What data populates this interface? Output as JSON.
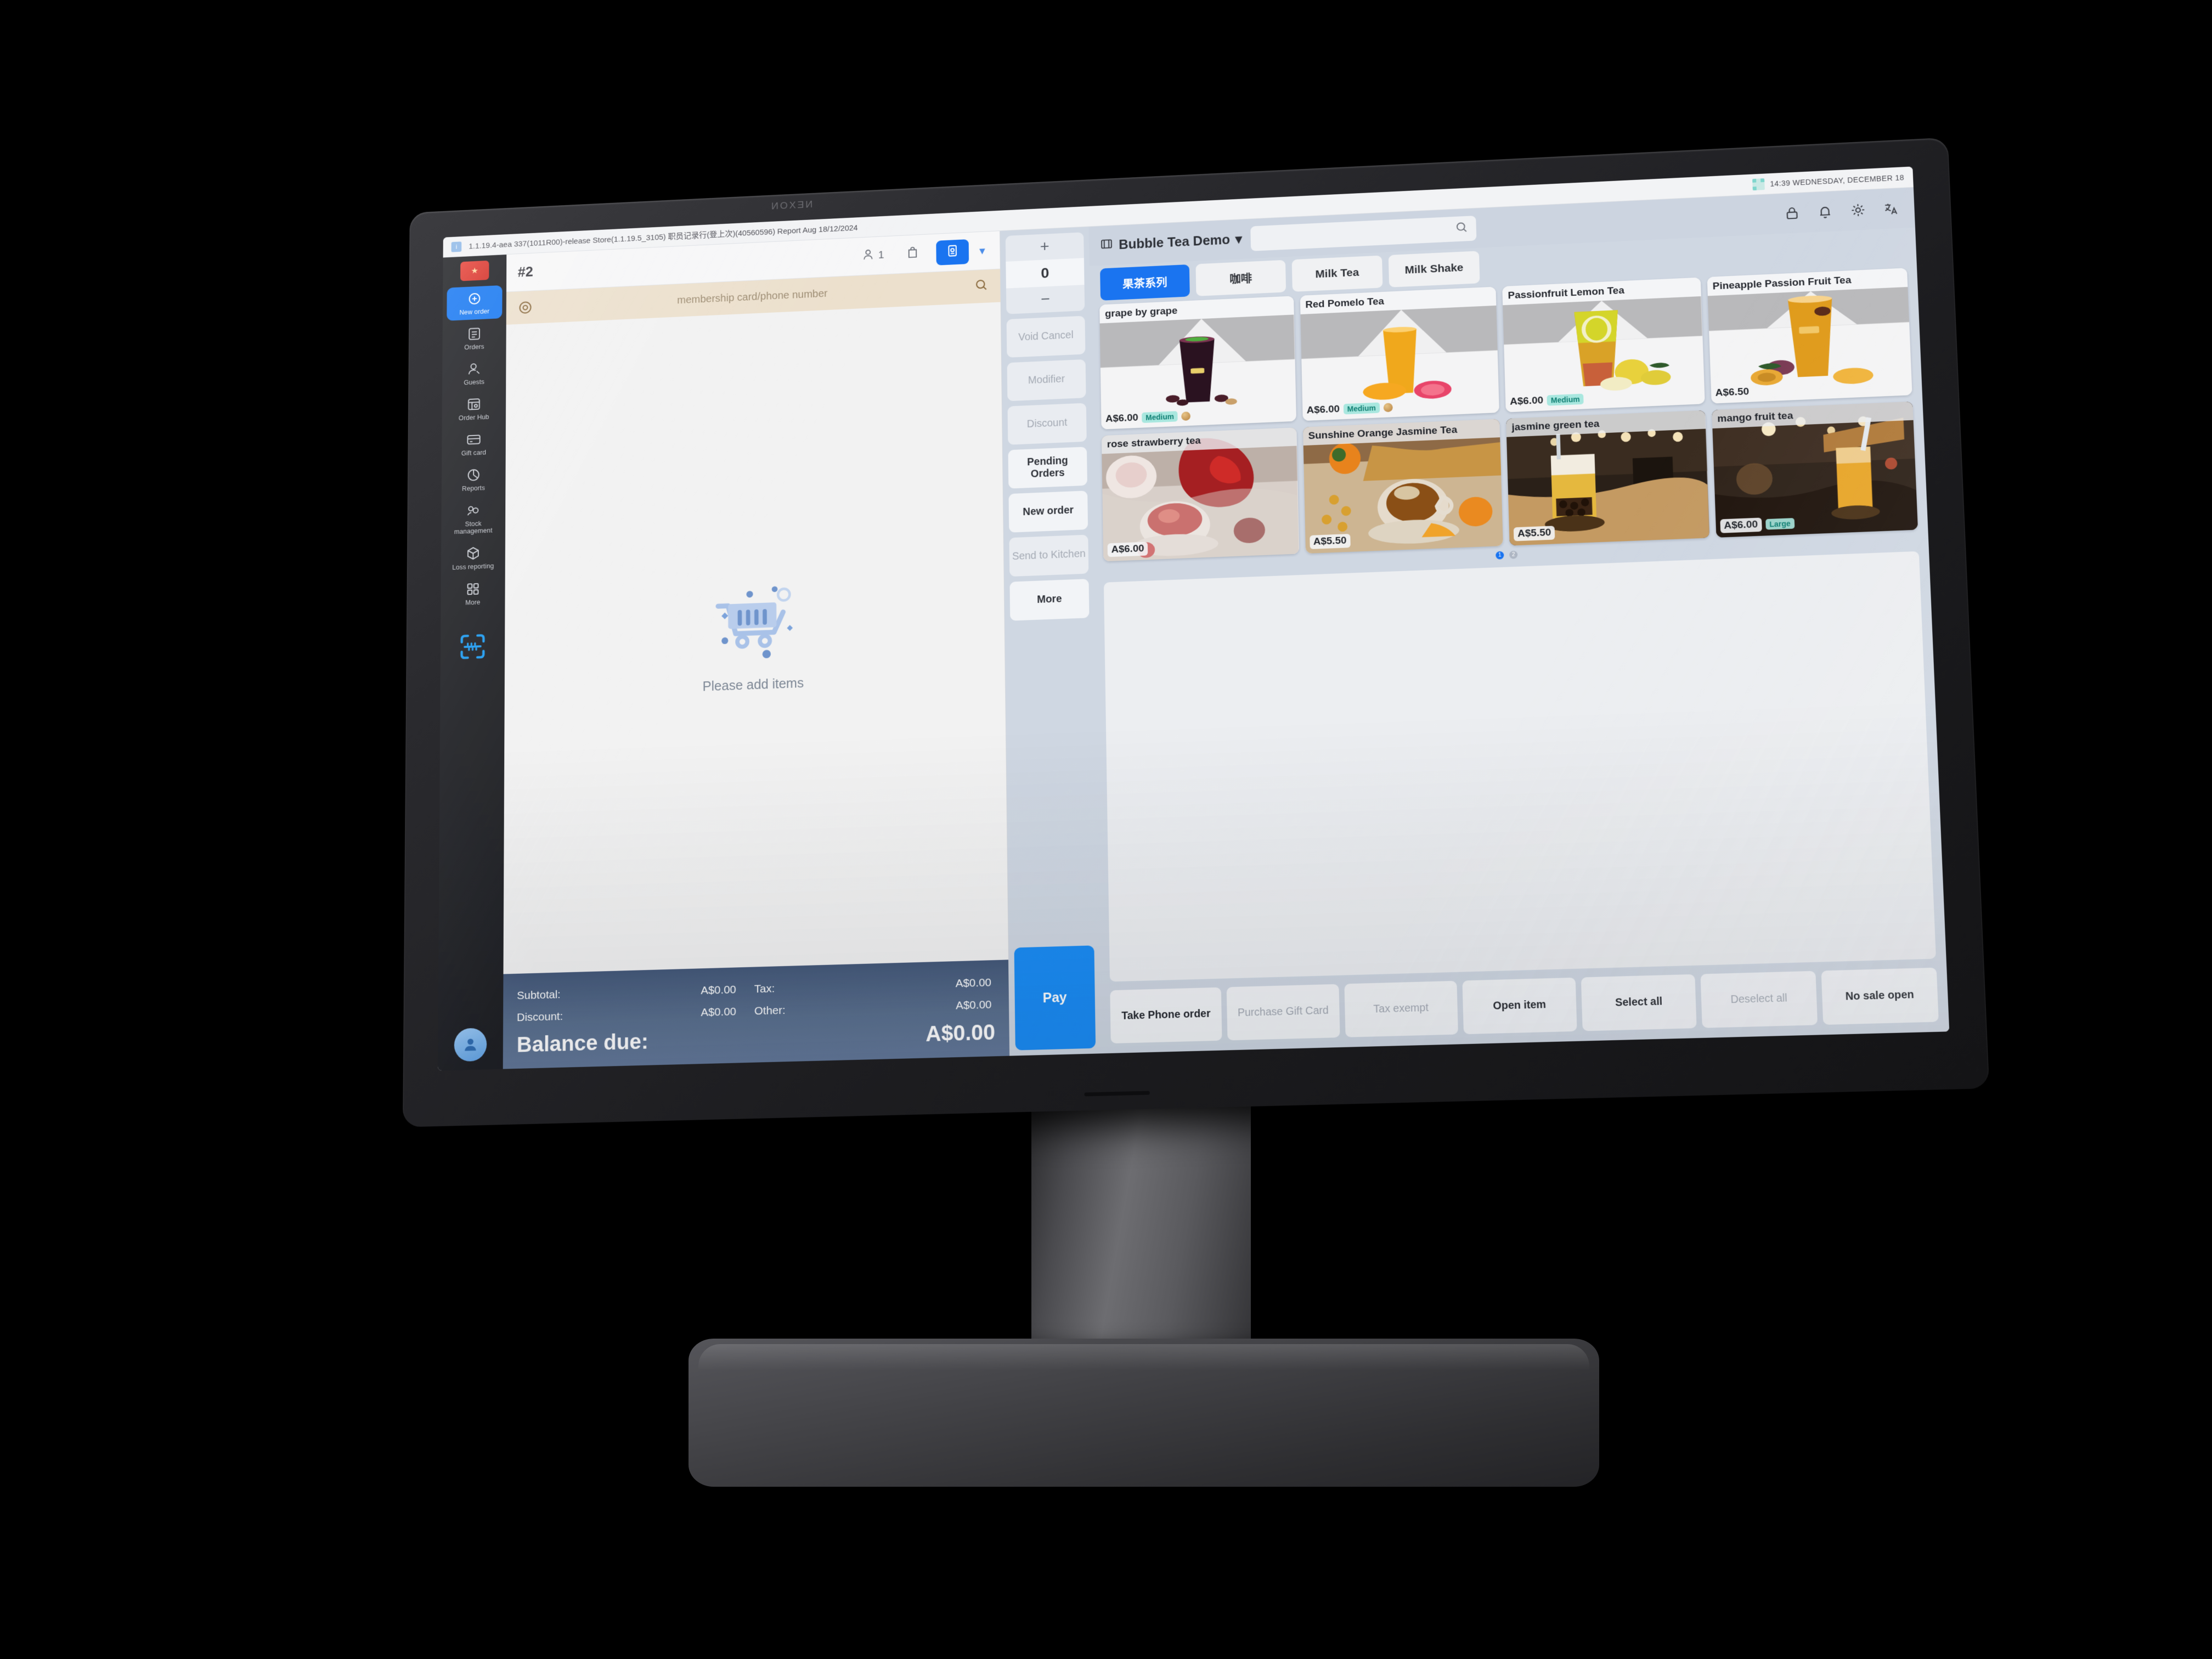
{
  "statusbar": {
    "debug_text": "1.1.19.4-aea 337(1011R00)-release  Store(1.1.19.5_3105)  职员记录行(登上次)(40560596)  Report Aug 18/12/2024",
    "clock": "14:39 WEDNESDAY, DECEMBER 18"
  },
  "sidebar": {
    "items": [
      {
        "label": "New order",
        "icon": "new-order-icon",
        "active": true
      },
      {
        "label": "Orders",
        "icon": "orders-icon",
        "active": false
      },
      {
        "label": "Guests",
        "icon": "guests-icon",
        "active": false
      },
      {
        "label": "Order Hub",
        "icon": "order-hub-icon",
        "active": false
      },
      {
        "label": "Gift card",
        "icon": "gift-card-icon",
        "active": false
      },
      {
        "label": "Reports",
        "icon": "reports-icon",
        "active": false
      },
      {
        "label": "Stock management",
        "icon": "stock-icon",
        "active": false
      },
      {
        "label": "Loss reporting",
        "icon": "loss-reporting-icon",
        "active": false
      },
      {
        "label": "More",
        "icon": "more-grid-icon",
        "active": false
      }
    ],
    "scan_icon": "barcode-scan-icon",
    "avatar_icon": "user-avatar-icon",
    "active_color": "#1878f2",
    "background": "#1f2024"
  },
  "ticket": {
    "order_number": "#2",
    "guest_count": "1",
    "membership_placeholder": "membership card/phone number",
    "membership_value": "",
    "empty_text": "Please add items",
    "totals": {
      "subtotal_label": "Subtotal:",
      "subtotal_value": "A$0.00",
      "tax_label": "Tax:",
      "tax_value": "A$0.00",
      "discount_label": "Discount:",
      "discount_value": "A$0.00",
      "other_label": "Other:",
      "other_value": "A$0.00",
      "balance_label": "Balance due:",
      "balance_value": "A$0.00"
    }
  },
  "actions": {
    "stepper": {
      "plus": "+",
      "value": "0",
      "minus": "−"
    },
    "buttons": [
      {
        "label": "Void Cancel",
        "disabled": true
      },
      {
        "label": "Modifier",
        "disabled": true
      },
      {
        "label": "Discount",
        "disabled": true
      },
      {
        "label": "Pending Orders",
        "disabled": false
      },
      {
        "label": "New order",
        "disabled": false
      },
      {
        "label": "Send to Kitchen",
        "disabled": true
      },
      {
        "label": "More",
        "disabled": false
      }
    ],
    "pay_label": "Pay",
    "pay_color": "#1a8cf5"
  },
  "menu": {
    "store_name": "Bubble Tea Demo",
    "search_placeholder": "",
    "search_value": "",
    "header_icons": [
      "lock-icon",
      "bell-icon",
      "settings-gear-icon",
      "language-icon"
    ],
    "tabs": [
      {
        "label": "果茶系列",
        "active": true
      },
      {
        "label": "咖啡",
        "active": false
      },
      {
        "label": "Milk Tea",
        "active": false
      },
      {
        "label": "Milk Shake",
        "active": false
      }
    ],
    "products": [
      {
        "name": "grape by grape",
        "price": "A$6.00",
        "badge": "Medium",
        "dot": true,
        "style": "plain",
        "img": "grape-drink"
      },
      {
        "name": "Red Pomelo Tea",
        "price": "A$6.00",
        "badge": "Medium",
        "dot": true,
        "style": "plain",
        "img": "pomelo-drink"
      },
      {
        "name": "Passionfruit Lemon Tea",
        "price": "A$6.00",
        "badge": "Medium",
        "dot": false,
        "style": "plain",
        "img": "lemon-drink"
      },
      {
        "name": "Pineapple Passion Fruit Tea",
        "price": "A$6.50",
        "badge": "",
        "dot": false,
        "style": "plain",
        "img": "pineapple-drink"
      },
      {
        "name": "rose strawberry tea",
        "price": "A$6.00",
        "badge": "",
        "dot": false,
        "style": "photo",
        "img": "rose-tea-photo"
      },
      {
        "name": "Sunshine Orange Jasmine Tea",
        "price": "A$5.50",
        "badge": "",
        "dot": false,
        "style": "photo",
        "img": "orange-jasmine-photo"
      },
      {
        "name": "jasmine green tea",
        "price": "A$5.50",
        "badge": "",
        "dot": false,
        "style": "photo",
        "img": "jasmine-green-photo"
      },
      {
        "name": "mango fruit tea",
        "price": "A$6.00",
        "badge": "Large",
        "dot": false,
        "style": "photo",
        "img": "mango-photo"
      }
    ],
    "pagination": [
      {
        "label": "1",
        "active": true
      },
      {
        "label": "2",
        "active": false
      }
    ],
    "bottom_buttons": [
      {
        "label": "Take Phone order",
        "disabled": false
      },
      {
        "label": "Purchase Gift Card",
        "disabled": true
      },
      {
        "label": "Tax exempt",
        "disabled": true
      },
      {
        "label": "Open item",
        "disabled": false
      },
      {
        "label": "Select all",
        "disabled": false
      },
      {
        "label": "Deselect all",
        "disabled": true
      },
      {
        "label": "No sale open",
        "disabled": false
      }
    ]
  },
  "device": {
    "brand": "NEXON"
  }
}
